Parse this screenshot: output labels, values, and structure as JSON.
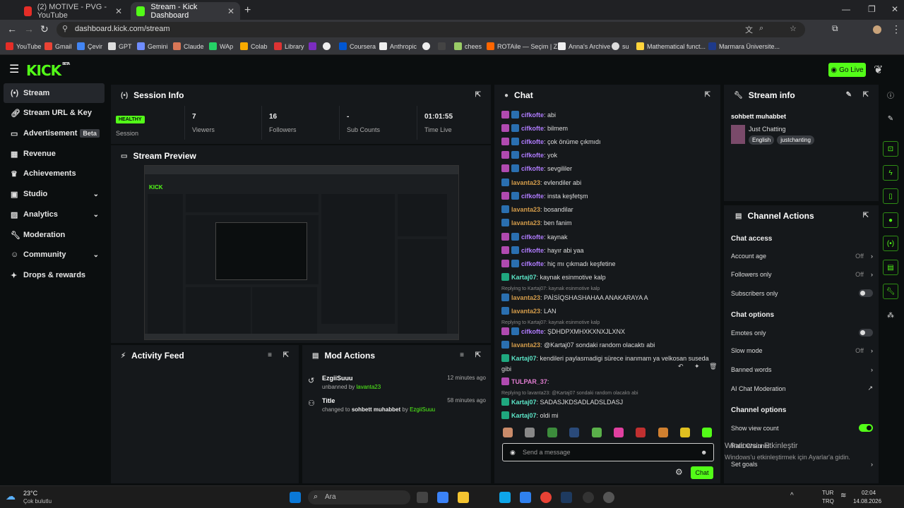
{
  "browser": {
    "tabs": [
      {
        "title": "(2) MOTIVE - PVG - YouTube"
      },
      {
        "title": "Stream - Kick Dashboard"
      }
    ],
    "url": "dashboard.kick.com/stream",
    "bookmarks": [
      "YouTube",
      "Gmail",
      "Çevir",
      "GPT",
      "Gemini",
      "Claude",
      "WAp",
      "Colab",
      "Library",
      "",
      "",
      "Coursera",
      "Anthropic",
      "",
      "",
      "chees",
      "ROTAile — Seçim | Z...",
      "Anna's Archive",
      "su",
      "Mathematical funct...",
      "Marmara Üniversite..."
    ]
  },
  "header": {
    "logo": "KICK",
    "logo_sup": "BETA",
    "go_live": "Go Live"
  },
  "sidebar": {
    "items": [
      {
        "label": "Stream",
        "icon": "stream-icon"
      },
      {
        "label": "Stream URL & Key",
        "icon": "link-icon"
      },
      {
        "label": "Advertisement",
        "badge": "Beta",
        "icon": "ad-icon"
      },
      {
        "label": "Revenue",
        "icon": "revenue-icon"
      },
      {
        "label": "Achievements",
        "icon": "trophy-icon"
      },
      {
        "label": "Studio",
        "icon": "studio-icon"
      },
      {
        "label": "Analytics",
        "icon": "analytics-icon"
      },
      {
        "label": "Moderation",
        "icon": "wrench-icon"
      },
      {
        "label": "Community",
        "icon": "community-icon"
      },
      {
        "label": "Drops & rewards",
        "icon": "drops-icon"
      }
    ]
  },
  "session": {
    "title": "Session Info",
    "stats": [
      {
        "value": "HEALTHY",
        "label": "Session"
      },
      {
        "value": "7",
        "label": "Viewers"
      },
      {
        "value": "16",
        "label": "Followers"
      },
      {
        "value": "-",
        "label": "Sub Counts"
      },
      {
        "value": "01:01:55",
        "label": "Time Live"
      }
    ]
  },
  "preview": {
    "title": "Stream Preview"
  },
  "activity": {
    "title": "Activity Feed"
  },
  "mod": {
    "title": "Mod Actions",
    "items": [
      {
        "title": "EzgiiSuuu",
        "desc_a": "unbanned by ",
        "desc_user": "lavanta23",
        "time": "12 minutes ago"
      },
      {
        "title": "Title",
        "desc_a": "changed to ",
        "desc_b": "sohbett muhabbet",
        "desc_c": " by ",
        "desc_user": "EzgiiSuuu",
        "time": "58 minutes ago"
      }
    ]
  },
  "chat": {
    "title": "Chat",
    "placeholder": "Send a message",
    "send": "Chat",
    "messages": [
      {
        "user": "cifkofte",
        "text": ": abi",
        "color": "#b07cff"
      },
      {
        "user": "cifkofte",
        "text": ": bilmem",
        "color": "#b07cff"
      },
      {
        "user": "cifkofte",
        "text": ": çok önüme çıkmıdı",
        "color": "#b07cff"
      },
      {
        "user": "cifkofte",
        "text": ": yok",
        "color": "#b07cff"
      },
      {
        "user": "cifkofte",
        "text": ": sevgililer",
        "color": "#b07cff"
      },
      {
        "user": "lavanta23",
        "text": ": evlendiler abi",
        "color": "#d29b4a"
      },
      {
        "user": "cifkofte",
        "text": ": insta keşfetşm",
        "color": "#b07cff"
      },
      {
        "user": "lavanta23",
        "text": ": bosandilar",
        "color": "#d29b4a"
      },
      {
        "user": "lavanta23",
        "text": ": ben fanim",
        "color": "#d29b4a"
      },
      {
        "user": "cifkofte",
        "text": ": kaynak",
        "color": "#b07cff"
      },
      {
        "user": "cifkofte",
        "text": ": hayır abi yaa",
        "color": "#b07cff"
      },
      {
        "user": "cifkofte",
        "text": ": hiç mı çıkmadı keşfetine",
        "color": "#b07cff"
      },
      {
        "user": "Kartaj07",
        "text": ": kaynak esinmotive kalp",
        "color": "#5ce6c8"
      },
      {
        "user": "lavanta23",
        "text": ": PAİSİQSHASHAHAA ANAKARAYA A",
        "color": "#d29b4a"
      },
      {
        "user": "lavanta23",
        "text": ": LAN",
        "color": "#d29b4a"
      },
      {
        "user": "cifkofte",
        "text": ": ŞDHDPXMHXKXNXJLXNX",
        "color": "#b07cff"
      },
      {
        "user": "lavanta23",
        "text": ": @Kartaj07 sondaki random olacaktı abi",
        "color": "#d29b4a"
      },
      {
        "user": "Kartaj07",
        "text": ": kendileri paylasmadigi sürece inanmam ya velkosan suseda",
        "color": "#5ce6c8"
      },
      {
        "user": "TULPAR_37",
        "text": ":",
        "color": "#e07cd0"
      },
      {
        "user": "Kartaj07",
        "text": ": SADASJKDSADLADSLDASJ",
        "color": "#5ce6c8"
      },
      {
        "user": "Kartaj07",
        "text": ": oldi mi",
        "color": "#5ce6c8"
      }
    ],
    "replies": [
      "Replying to Kartaj07: kaynak esinmotive kalp",
      "Replying to Kartaj07: kaynak esinmotive kalp",
      "Replying to lavanta23: @Kartaj07 sondaki random olacaktı abi"
    ],
    "wrap": "gibi"
  },
  "streaminfo": {
    "title": "Stream info",
    "stream_title": "sohbett muhabbet",
    "category": "Just Chatting",
    "tags": [
      "English",
      "justchanting"
    ]
  },
  "actions": {
    "title": "Channel Actions",
    "chat_access": "Chat access",
    "account_age": "Account age",
    "followers_only": "Followers only",
    "off": "Off",
    "subscribers_only": "Subscribers only",
    "chat_options": "Chat options",
    "emotes_only": "Emotes only",
    "slow_mode": "Slow mode",
    "banned_words": "Banned words",
    "ai_mod": "AI Chat Moderation",
    "channel_options": "Channel options",
    "show_view": "Show view count",
    "raid": "Raid Channel",
    "set_goals": "Set goals"
  },
  "windows": {
    "activate": "Windows'u Etkinleştir",
    "activate_sub": "Windows'u etkinleştirmek için Ayarlar'a gidin.",
    "temp": "23°C",
    "weather": "Çok bulutlu",
    "search": "Ara",
    "lang": "TUR",
    "lang2": "TRQ",
    "time": "02:04",
    "date": "14.08.2026"
  }
}
